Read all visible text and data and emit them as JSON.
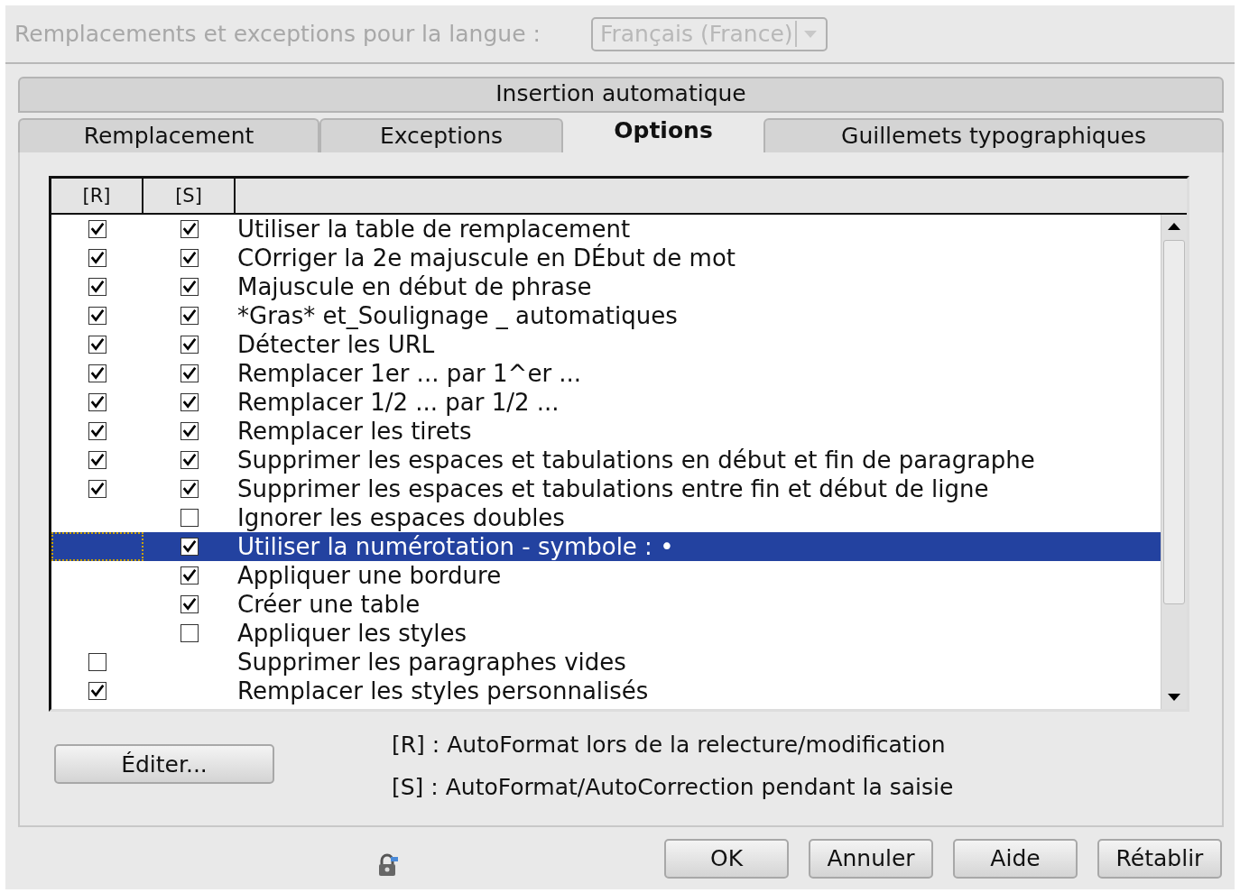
{
  "language": {
    "label": "Remplacements et exceptions pour la langue :",
    "value": "Français (France)",
    "disabled": true
  },
  "tab_group": "Insertion automatique",
  "tabs": [
    {
      "label": "Remplacement",
      "selected": false
    },
    {
      "label": "Exceptions",
      "selected": false
    },
    {
      "label": "Options",
      "selected": true
    },
    {
      "label": "Guillemets typographiques",
      "selected": false
    }
  ],
  "table": {
    "columns": [
      "[R]",
      "[S]"
    ],
    "rows": [
      {
        "label": "Utiliser la table de remplacement",
        "r_checked": true,
        "s_checked": true,
        "selected": false
      },
      {
        "label": "COrriger la 2e majuscule en DÉbut de mot",
        "r_checked": true,
        "s_checked": true,
        "selected": false
      },
      {
        "label": "Majuscule en début de phrase",
        "r_checked": true,
        "s_checked": true,
        "selected": false
      },
      {
        "label": "*Gras* et_Soulignage _ automatiques",
        "r_checked": true,
        "s_checked": true,
        "selected": false
      },
      {
        "label": "Détecter les URL",
        "r_checked": true,
        "s_checked": true,
        "selected": false
      },
      {
        "label": "Remplacer 1er ... par 1^er ...",
        "r_checked": true,
        "s_checked": true,
        "selected": false
      },
      {
        "label": "Remplacer 1/2 ... par 1/2 ...",
        "r_checked": true,
        "s_checked": true,
        "selected": false
      },
      {
        "label": "Remplacer les tirets",
        "r_checked": true,
        "s_checked": true,
        "selected": false
      },
      {
        "label": "Supprimer les espaces et tabulations en début et fin de paragraphe",
        "r_checked": true,
        "s_checked": true,
        "selected": false
      },
      {
        "label": "Supprimer les espaces et tabulations entre fin et début de ligne",
        "r_checked": true,
        "s_checked": true,
        "selected": false
      },
      {
        "label": "Ignorer les espaces doubles",
        "s_checked": false,
        "selected": false
      },
      {
        "label": "Utiliser la numérotation - symbole : •",
        "s_checked": true,
        "selected": true
      },
      {
        "label": "Appliquer une bordure",
        "s_checked": true,
        "selected": false
      },
      {
        "label": "Créer une table",
        "s_checked": true,
        "selected": false
      },
      {
        "label": "Appliquer les styles",
        "s_checked": false,
        "selected": false
      },
      {
        "label": "Supprimer les paragraphes vides",
        "r_checked": false,
        "selected": false
      },
      {
        "label": "Remplacer les styles personnalisés",
        "r_checked": true,
        "selected": false
      }
    ]
  },
  "edit_button": "Éditer...",
  "legend": [
    "[R] : AutoFormat lors de la relecture/modification",
    "[S] : AutoFormat/AutoCorrection pendant la saisie"
  ],
  "buttons": [
    "OK",
    "Annuler",
    "Aide",
    "Rétablir"
  ]
}
